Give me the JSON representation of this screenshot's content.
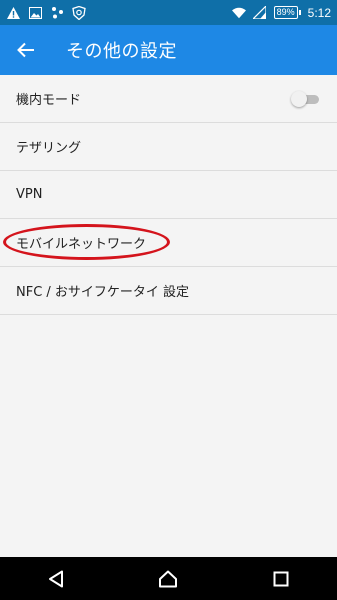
{
  "status_bar": {
    "icons": [
      "warning-icon",
      "image-icon",
      "connection-icon",
      "shield-app-icon"
    ],
    "battery_level": "89%",
    "time": "5:12",
    "background": "#0f6fa8"
  },
  "app_bar": {
    "title": "その他の設定",
    "background": "#1e88e5",
    "back_icon": "arrow-back-icon"
  },
  "settings": {
    "items": [
      {
        "label": "機内モード",
        "toggle": false
      },
      {
        "label": "テザリング"
      },
      {
        "label": "VPN"
      },
      {
        "label": "モバイルネットワーク",
        "highlighted": true
      },
      {
        "label": "NFC / おサイフケータイ 設定"
      }
    ],
    "highlight_color": "#d4141c"
  },
  "nav_bar": {
    "buttons": [
      "back-triangle-icon",
      "home-icon",
      "recents-icon"
    ]
  }
}
